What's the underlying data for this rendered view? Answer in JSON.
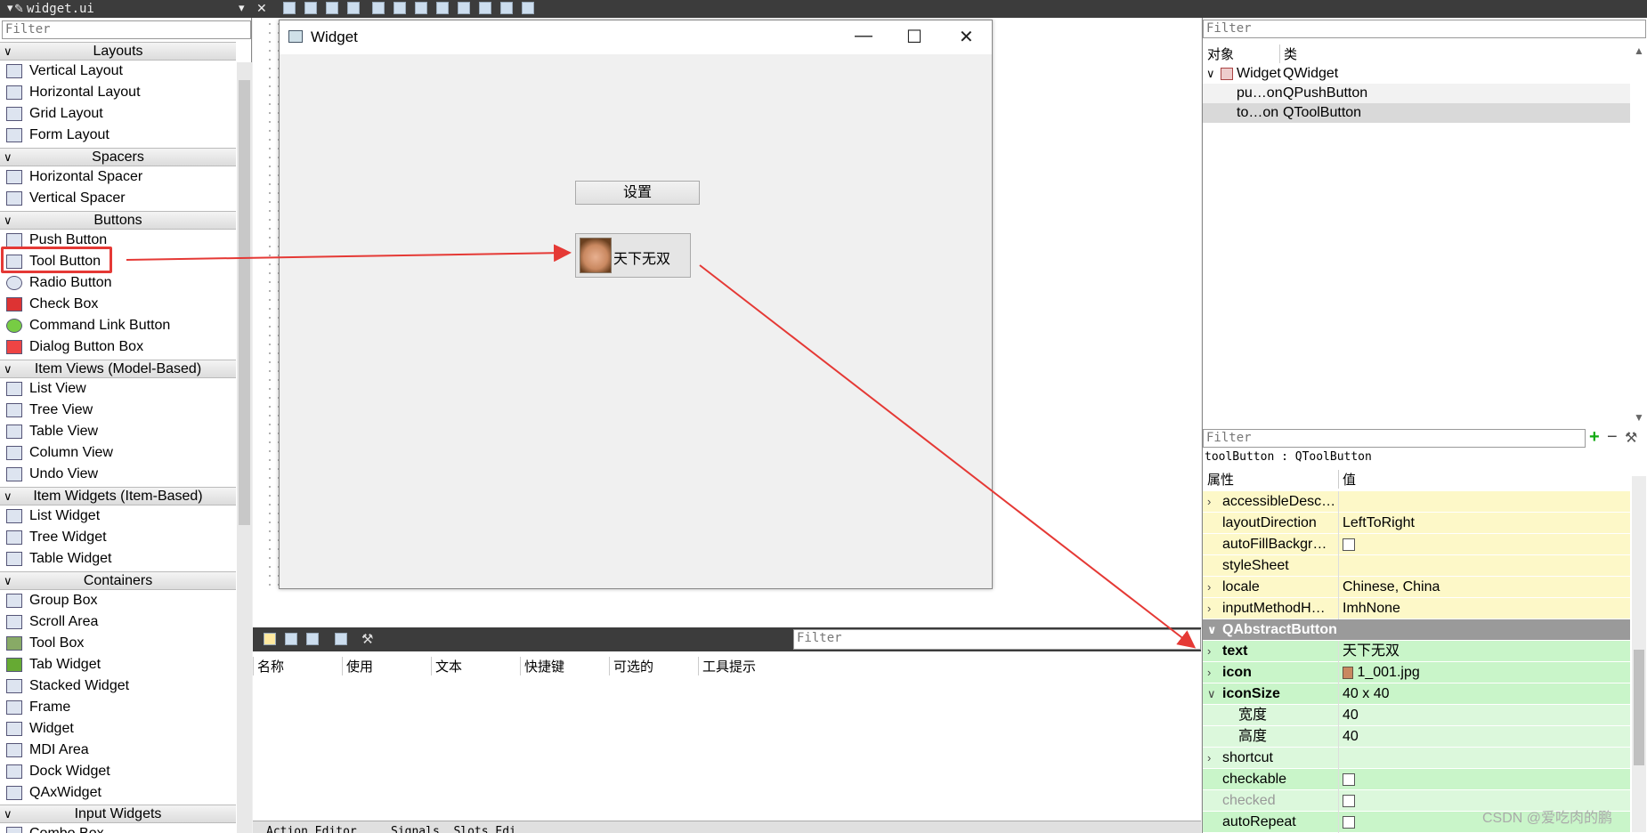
{
  "titlebar": {
    "file_tab": "widget.ui"
  },
  "widget_box": {
    "filter_placeholder": "Filter",
    "categories": {
      "layouts": "Layouts",
      "spacers": "Spacers",
      "buttons": "Buttons",
      "item_views": "Item Views (Model-Based)",
      "item_widgets": "Item Widgets (Item-Based)",
      "containers": "Containers",
      "input_widgets": "Input Widgets"
    },
    "items": {
      "vertical_layout": "Vertical Layout",
      "horizontal_layout": "Horizontal Layout",
      "grid_layout": "Grid Layout",
      "form_layout": "Form Layout",
      "horizontal_spacer": "Horizontal Spacer",
      "vertical_spacer": "Vertical Spacer",
      "push_button": "Push Button",
      "tool_button": "Tool Button",
      "radio_button": "Radio Button",
      "check_box": "Check Box",
      "command_link_button": "Command Link Button",
      "dialog_button_box": "Dialog Button Box",
      "list_view": "List View",
      "tree_view": "Tree View",
      "table_view": "Table View",
      "column_view": "Column View",
      "undo_view": "Undo View",
      "list_widget": "List Widget",
      "tree_widget": "Tree Widget",
      "table_widget": "Table Widget",
      "group_box": "Group Box",
      "scroll_area": "Scroll Area",
      "tool_box": "Tool Box",
      "tab_widget": "Tab Widget",
      "stacked_widget": "Stacked Widget",
      "frame": "Frame",
      "widget": "Widget",
      "mdi_area": "MDI Area",
      "dock_widget": "Dock Widget",
      "qax_widget": "QAxWidget",
      "combo_box": "Combo Box"
    }
  },
  "form": {
    "title": "Widget",
    "minimize": "—",
    "maximize": "☐",
    "close": "✕",
    "push_button_text": "设置",
    "tool_button_text": "天下无双"
  },
  "action_editor": {
    "filter_placeholder": "Filter",
    "columns": [
      "名称",
      "使用",
      "文本",
      "快捷键",
      "可选的",
      "工具提示"
    ],
    "tabs": [
      "Action Editor",
      "Signals _Slots Edi…"
    ]
  },
  "object_inspector": {
    "filter_placeholder": "Filter",
    "col_object": "对象",
    "col_class": "类",
    "rows": [
      {
        "object": "Widget",
        "class": "QWidget"
      },
      {
        "object": "pu…on",
        "class": "QPushButton"
      },
      {
        "object": "to…on",
        "class": "QToolButton"
      }
    ]
  },
  "property_editor": {
    "filter_placeholder": "Filter",
    "object_label": "toolButton : QToolButton",
    "col_property": "属性",
    "col_value": "值",
    "rows": [
      {
        "name": "accessibleDesc…",
        "value": ""
      },
      {
        "name": "layoutDirection",
        "value": "LeftToRight"
      },
      {
        "name": "autoFillBackgr…",
        "value": ""
      },
      {
        "name": "styleSheet",
        "value": ""
      },
      {
        "name": "locale",
        "value": "Chinese, China"
      },
      {
        "name": "inputMethodH…",
        "value": "ImhNone"
      },
      {
        "name": "QAbstractButton",
        "value": ""
      },
      {
        "name": "text",
        "value": "天下无双"
      },
      {
        "name": "icon",
        "value": "1_001.jpg"
      },
      {
        "name": "iconSize",
        "value": "40 x 40"
      },
      {
        "name": "宽度",
        "value": "40"
      },
      {
        "name": "高度",
        "value": "40"
      },
      {
        "name": "shortcut",
        "value": ""
      },
      {
        "name": "checkable",
        "value": ""
      },
      {
        "name": "checked",
        "value": ""
      },
      {
        "name": "autoRepeat",
        "value": ""
      }
    ]
  },
  "watermark": "CSDN @爱吃肉的鹏",
  "colors": {
    "annotation": "#e53935",
    "class_header": "#9a9a9a",
    "qabstract_rows": "#c9f5c9",
    "qwidget_rows": "#fdf8c8"
  }
}
